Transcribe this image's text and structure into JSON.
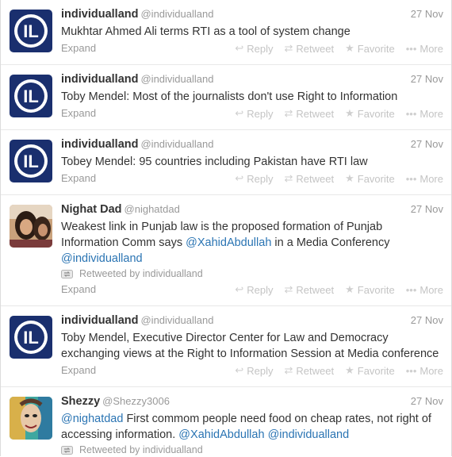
{
  "actions": {
    "reply": "Reply",
    "retweet": "Retweet",
    "favorite": "Favorite",
    "more": "More",
    "expand": "Expand"
  },
  "icons": {
    "reply": "reply-arrow-icon",
    "retweet": "retweet-icon",
    "favorite": "star-icon",
    "more": "ellipsis-icon"
  },
  "colors": {
    "link": "#2a74b3",
    "logo_blue": "#1a2f6e",
    "muted": "#999999"
  },
  "tweets": [
    {
      "name": "individualland",
      "handle": "@individualland",
      "time": "27 Nov",
      "text": "Mukhtar Ahmed Ali terms RTI as a tool of system change"
    },
    {
      "name": "individualland",
      "handle": "@individualland",
      "time": "27 Nov",
      "text": "Toby Mendel: Most of the journalists don't use Right to Information"
    },
    {
      "name": "individualland",
      "handle": "@individualland",
      "time": "27 Nov",
      "text": "Tobey Mendel: 95 countries including Pakistan have RTI law"
    },
    {
      "name": "Nighat Dad",
      "handle": "@nighatdad",
      "time": "27 Nov",
      "text_a": "Weakest link in Punjab law is the proposed formation of Punjab Information Comm says ",
      "link1": "@XahidAbdullah",
      "text_b": " in a Media Conferency ",
      "link2": "@individualland",
      "retweeted_by": "Retweeted by individualland"
    },
    {
      "name": "individualland",
      "handle": "@individualland",
      "time": "27 Nov",
      "text": "Toby Mendel, Executive Director Center for Law and Democracy exchanging views at the Right to Information Session at Media conference"
    },
    {
      "name": "Shezzy",
      "handle": "@Shezzy3006",
      "time": "27 Nov",
      "link0": "@nighatdad",
      "text_a": " First commom people need food on cheap rates, not right of accessing information. ",
      "link1": "@XahidAbdullah",
      "link2": "@individualland",
      "retweeted_by": "Retweeted by individualland"
    }
  ]
}
